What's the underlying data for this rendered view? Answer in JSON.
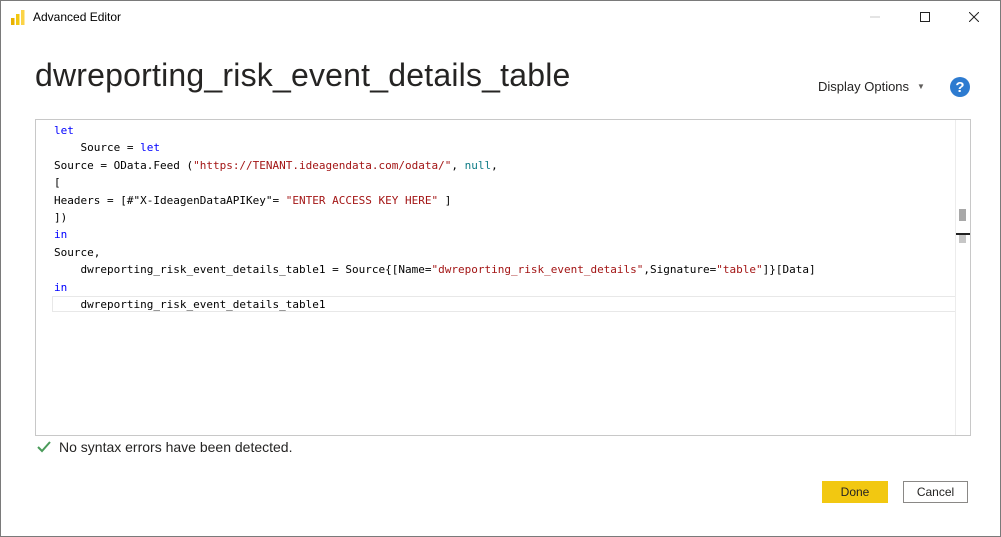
{
  "window": {
    "title": "Advanced Editor",
    "controls": {
      "minimize": "minimize-icon",
      "maximize": "maximize-icon",
      "close": "close-icon"
    }
  },
  "header": {
    "query_name": "dwreporting_risk_event_details_table",
    "display_options_label": "Display Options",
    "help_label": "?"
  },
  "editor": {
    "lines": [
      [
        {
          "t": "let",
          "c": "kw"
        }
      ],
      [
        {
          "t": "    Source = ",
          "c": ""
        },
        {
          "t": "let",
          "c": "kw"
        }
      ],
      [
        {
          "t": "Source = OData.Feed (",
          "c": ""
        },
        {
          "t": "\"https://TENANT.ideagendata.com/odata/\"",
          "c": "str"
        },
        {
          "t": ", ",
          "c": ""
        },
        {
          "t": "null",
          "c": "nul"
        },
        {
          "t": ",",
          "c": ""
        }
      ],
      [
        {
          "t": "[",
          "c": ""
        }
      ],
      [
        {
          "t": "Headers = [#\"X-IdeagenDataAPIKey\"= ",
          "c": ""
        },
        {
          "t": "\"ENTER ACCESS KEY HERE\"",
          "c": "str"
        },
        {
          "t": " ]",
          "c": ""
        }
      ],
      [
        {
          "t": "])",
          "c": ""
        }
      ],
      [
        {
          "t": "in",
          "c": "kw"
        }
      ],
      [
        {
          "t": "Source,",
          "c": ""
        }
      ],
      [
        {
          "t": "    dwreporting_risk_event_details_table1 = Source{[Name=",
          "c": ""
        },
        {
          "t": "\"dwreporting_risk_event_details\"",
          "c": "str"
        },
        {
          "t": ",Signature=",
          "c": ""
        },
        {
          "t": "\"table\"",
          "c": "str"
        },
        {
          "t": "]}[Data]",
          "c": ""
        }
      ],
      [
        {
          "t": "in",
          "c": "kw"
        }
      ],
      [
        {
          "t": "    dwreporting_risk_event_details_table1",
          "c": ""
        }
      ]
    ]
  },
  "status": {
    "icon": "checkmark-icon",
    "message": "No syntax errors have been detected."
  },
  "footer": {
    "done_label": "Done",
    "cancel_label": "Cancel"
  },
  "colors": {
    "accent_button": "#f2c811",
    "keyword": "#0000ff",
    "string": "#a31515",
    "null_literal": "#0e7c86",
    "help_icon": "#2d7bd0",
    "check_icon": "#4a9b5a"
  }
}
